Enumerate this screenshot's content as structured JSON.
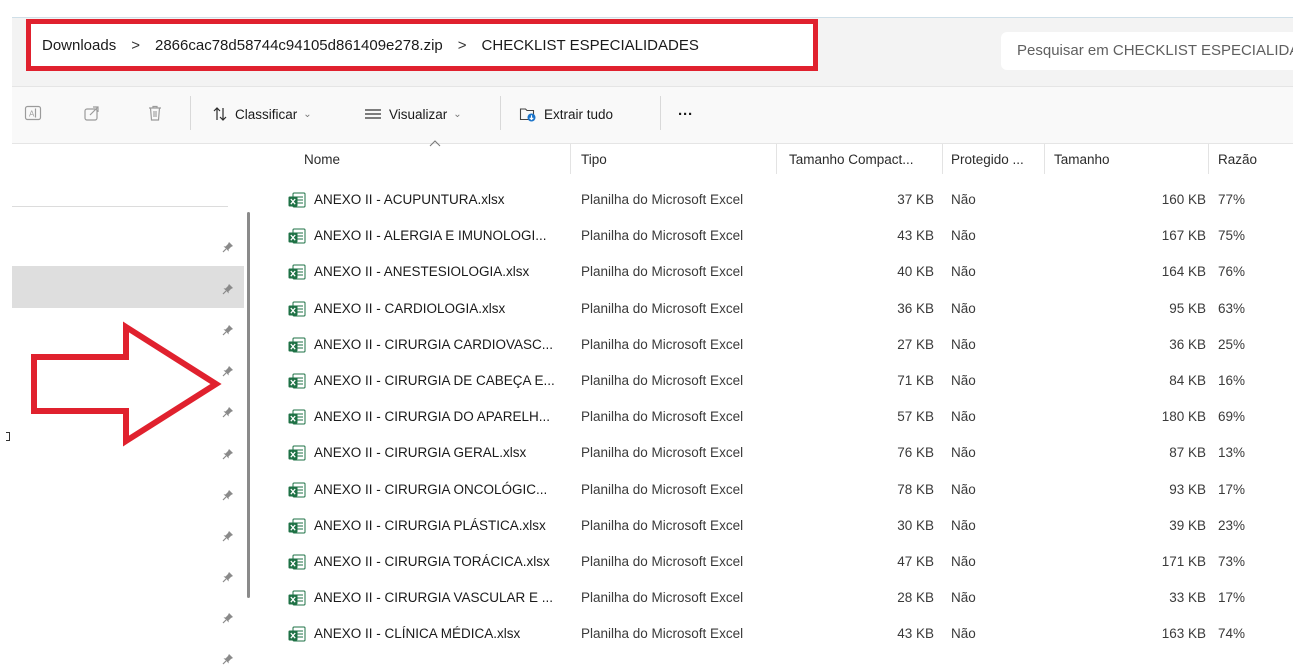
{
  "address": {
    "crumbs": [
      "Downloads",
      "2866cac78d58744c94105d861409e278.zip",
      "CHECKLIST ESPECIALIDADES"
    ],
    "separator": ">"
  },
  "search": {
    "placeholder": "Pesquisar em CHECKLIST ESPECIALIDADES"
  },
  "toolbar": {
    "sort_label": "Classificar",
    "view_label": "Visualizar",
    "extract_label": "Extrair tudo",
    "more_label": "···"
  },
  "columns": {
    "name": "Nome",
    "type": "Tipo",
    "compressed": "Tamanho Compact...",
    "protected": "Protegido ...",
    "size": "Tamanho",
    "ratio": "Razão"
  },
  "files": [
    {
      "name": "ANEXO II - ACUPUNTURA.xlsx",
      "type": "Planilha do Microsoft Excel",
      "compressed": "37 KB",
      "protected": "Não",
      "size": "160 KB",
      "ratio": "77%"
    },
    {
      "name": "ANEXO II - ALERGIA E IMUNOLOGI...",
      "type": "Planilha do Microsoft Excel",
      "compressed": "43 KB",
      "protected": "Não",
      "size": "167 KB",
      "ratio": "75%"
    },
    {
      "name": "ANEXO II - ANESTESIOLOGIA.xlsx",
      "type": "Planilha do Microsoft Excel",
      "compressed": "40 KB",
      "protected": "Não",
      "size": "164 KB",
      "ratio": "76%"
    },
    {
      "name": "ANEXO II - CARDIOLOGIA.xlsx",
      "type": "Planilha do Microsoft Excel",
      "compressed": "36 KB",
      "protected": "Não",
      "size": "95 KB",
      "ratio": "63%"
    },
    {
      "name": "ANEXO II - CIRURGIA CARDIOVASC...",
      "type": "Planilha do Microsoft Excel",
      "compressed": "27 KB",
      "protected": "Não",
      "size": "36 KB",
      "ratio": "25%"
    },
    {
      "name": "ANEXO II - CIRURGIA DE CABEÇA E...",
      "type": "Planilha do Microsoft Excel",
      "compressed": "71 KB",
      "protected": "Não",
      "size": "84 KB",
      "ratio": "16%"
    },
    {
      "name": "ANEXO II - CIRURGIA DO APARELH...",
      "type": "Planilha do Microsoft Excel",
      "compressed": "57 KB",
      "protected": "Não",
      "size": "180 KB",
      "ratio": "69%"
    },
    {
      "name": "ANEXO II - CIRURGIA GERAL.xlsx",
      "type": "Planilha do Microsoft Excel",
      "compressed": "76 KB",
      "protected": "Não",
      "size": "87 KB",
      "ratio": "13%"
    },
    {
      "name": "ANEXO II - CIRURGIA ONCOLÓGIC...",
      "type": "Planilha do Microsoft Excel",
      "compressed": "78 KB",
      "protected": "Não",
      "size": "93 KB",
      "ratio": "17%"
    },
    {
      "name": "ANEXO II - CIRURGIA PLÁSTICA.xlsx",
      "type": "Planilha do Microsoft Excel",
      "compressed": "30 KB",
      "protected": "Não",
      "size": "39 KB",
      "ratio": "23%"
    },
    {
      "name": "ANEXO II - CIRURGIA TORÁCICA.xlsx",
      "type": "Planilha do Microsoft Excel",
      "compressed": "47 KB",
      "protected": "Não",
      "size": "171 KB",
      "ratio": "73%"
    },
    {
      "name": "ANEXO II - CIRURGIA VASCULAR E ...",
      "type": "Planilha do Microsoft Excel",
      "compressed": "28 KB",
      "protected": "Não",
      "size": "33 KB",
      "ratio": "17%"
    },
    {
      "name": "ANEXO II - CLÍNICA MÉDICA.xlsx",
      "type": "Planilha do Microsoft Excel",
      "compressed": "43 KB",
      "protected": "Não",
      "size": "163 KB",
      "ratio": "74%"
    }
  ],
  "colors": {
    "annotation_red": "#e0212e",
    "excel_green": "#1e7145",
    "extract_blue": "#1a73c9"
  },
  "icons": {
    "toolbar": [
      "rename-icon",
      "share-icon",
      "delete-icon",
      "sort-icon",
      "view-icon",
      "extract-icon"
    ],
    "file": "excel-file-icon",
    "nav": "pin-icon"
  }
}
